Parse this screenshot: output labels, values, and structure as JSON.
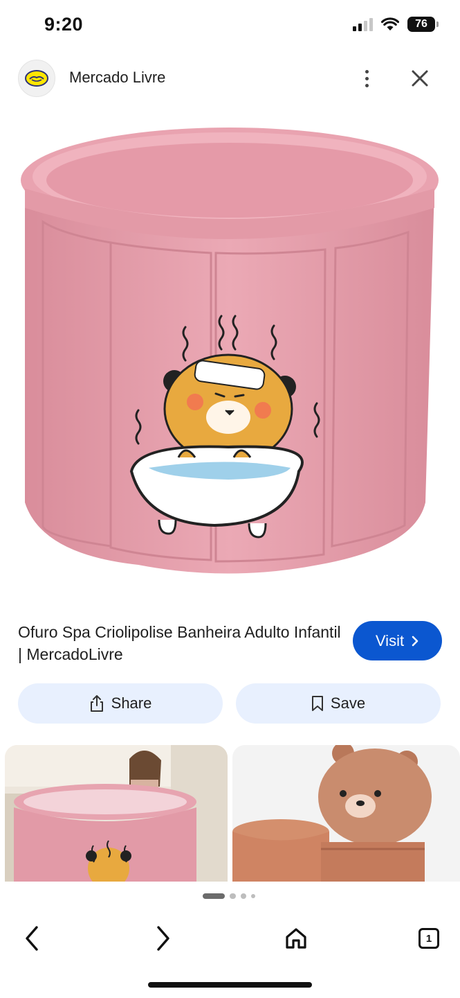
{
  "status_bar": {
    "time": "9:20",
    "battery": "76",
    "icons": [
      "cellular-signal-icon",
      "wifi-icon",
      "battery-icon"
    ]
  },
  "header": {
    "site_name": "Mercado Livre",
    "logo_icon": "mercado-livre-handshake-logo",
    "menu_icon": "more-vert-icon",
    "close_icon": "close-icon"
  },
  "main": {
    "image_description_icon": "pink-folding-bathtub-with-bear-sticker-image",
    "title": "Ofuro Spa Criolipolise Banheira Adulto Infantil | MercadoLivre",
    "visit_label": "Visit",
    "share_label": "Share",
    "save_label": "Save"
  },
  "colors": {
    "accent": "#0b57d0",
    "button_bg": "#e8f0fe",
    "tub_pink": "#e7a0ad"
  },
  "pager": {
    "dots": 4,
    "active_index": 0
  },
  "bottom_nav": {
    "tabs_count": "1",
    "icons": [
      "back-icon",
      "forward-icon",
      "home-icon",
      "tabs-icon"
    ]
  }
}
